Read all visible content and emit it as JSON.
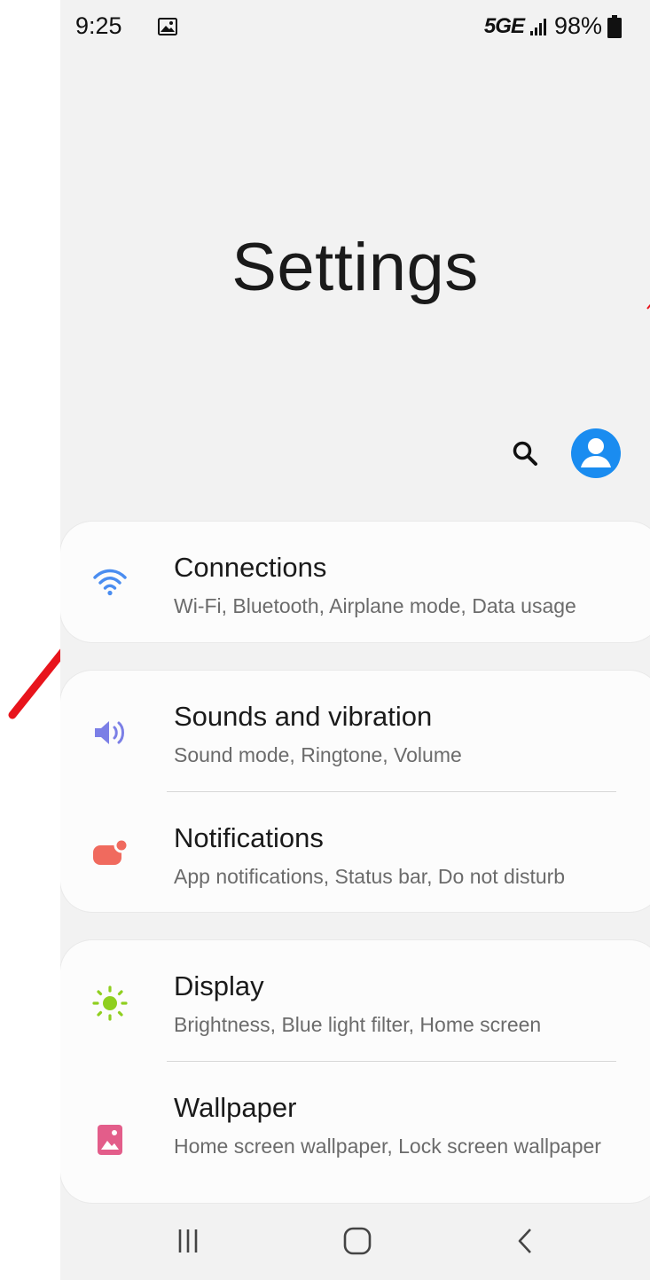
{
  "status_bar": {
    "time": "9:25",
    "network": "5GE",
    "battery": "98%"
  },
  "header": {
    "title": "Settings"
  },
  "settings": [
    {
      "title": "Connections",
      "subtitle": "Wi-Fi, Bluetooth, Airplane mode, Data usage",
      "icon": "wifi-icon",
      "color": "#4a8df0"
    },
    {
      "title": "Sounds and vibration",
      "subtitle": "Sound mode, Ringtone, Volume",
      "icon": "volume-icon",
      "color": "#7b7fe6"
    },
    {
      "title": "Notifications",
      "subtitle": "App notifications, Status bar, Do not disturb",
      "icon": "notification-icon",
      "color": "#f06a5e"
    },
    {
      "title": "Display",
      "subtitle": "Brightness, Blue light filter, Home screen",
      "icon": "brightness-icon",
      "color": "#8fcf1f"
    },
    {
      "title": "Wallpaper",
      "subtitle": "Home screen wallpaper, Lock screen wallpaper",
      "icon": "wallpaper-icon",
      "color": "#e35d8a"
    }
  ],
  "colors": {
    "accent": "#1a8cf0",
    "background": "#f2f2f2",
    "card": "#fcfcfc",
    "annotation_arrow": "#e8141c"
  },
  "icons": {
    "search": "search-icon",
    "profile": "profile-icon",
    "recents": "recents-icon",
    "home": "home-icon",
    "back": "back-icon"
  }
}
